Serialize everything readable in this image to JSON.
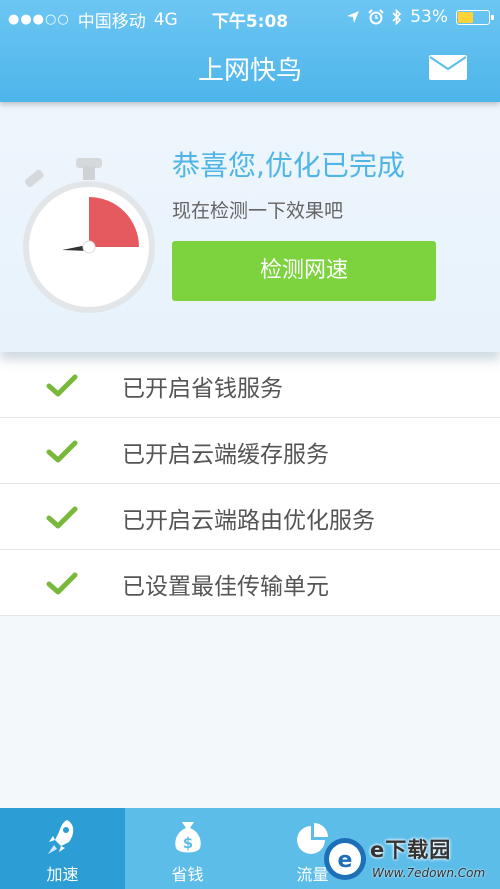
{
  "status_bar": {
    "carrier": "中国移动",
    "network": "4G",
    "time": "下午5:08",
    "battery": "53%",
    "battery_level": 0.53
  },
  "header": {
    "title": "上网快鸟",
    "mail_icon": "mail-icon"
  },
  "card": {
    "headline": "恭喜您,优化已完成",
    "subline": "现在检测一下效果吧",
    "button_label": "检测网速",
    "stopwatch_icon": "stopwatch-icon"
  },
  "services": [
    {
      "label": "已开启省钱服务",
      "icon": "check-icon"
    },
    {
      "label": "已开启云端缓存服务",
      "icon": "check-icon"
    },
    {
      "label": "已开启云端路由优化服务",
      "icon": "check-icon"
    },
    {
      "label": "已设置最佳传输单元",
      "icon": "check-icon"
    }
  ],
  "tabs": [
    {
      "label": "加速",
      "icon": "rocket-icon",
      "active": true
    },
    {
      "label": "省钱",
      "icon": "money-bag-icon",
      "active": false
    },
    {
      "label": "流量",
      "icon": "pie-chart-icon",
      "active": false
    },
    {
      "label": "",
      "icon": "",
      "active": false
    }
  ],
  "watermark": {
    "text": "e下载园",
    "url": "Www.7edown.Com"
  },
  "colors": {
    "accent_blue": "#4fb5e6",
    "button_green": "#7cd33e",
    "check_green": "#7ab83c",
    "tab_active": "#2d9dd6"
  }
}
